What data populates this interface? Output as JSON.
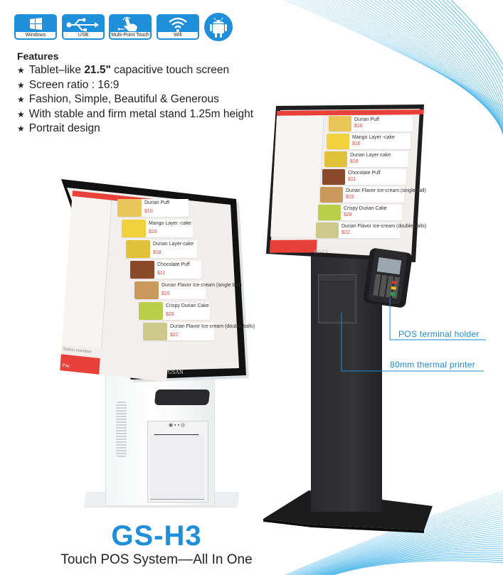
{
  "badges": [
    {
      "icon": "windows-icon",
      "label": "Windows"
    },
    {
      "icon": "usb-icon",
      "label": "USB"
    },
    {
      "icon": "multi-touch-icon",
      "label": "Multi-Point Touch"
    },
    {
      "icon": "wifi-icon",
      "label": "Wifi"
    },
    {
      "icon": "android-icon",
      "label": ""
    }
  ],
  "features": {
    "title": "Features",
    "items": [
      {
        "pre": "Tablet–like ",
        "bold": "21.5\"",
        "post": " capacitive touch screen"
      },
      {
        "pre": "Screen ratio : 16:9",
        "bold": "",
        "post": ""
      },
      {
        "pre": "Fashion, Simple, Beautiful & Generous",
        "bold": "",
        "post": ""
      },
      {
        "pre": "With stable and firm metal stand 1.25m height",
        "bold": "",
        "post": ""
      },
      {
        "pre": "Portrait design",
        "bold": "",
        "post": ""
      }
    ]
  },
  "menu": {
    "items": [
      {
        "name": "Durian Puff",
        "price": "$10",
        "color": "#e9c65a"
      },
      {
        "name": "Mango  Layer -cake",
        "price": "$16",
        "color": "#f2d23c"
      },
      {
        "name": "Durian Layer-cake",
        "price": "$18",
        "color": "#e2c13a"
      },
      {
        "name": "Chocolate Puff",
        "price": "$11",
        "color": "#8a4a2a"
      },
      {
        "name": "Durian Flavor Ice-cream  (single ball)",
        "price": "$15",
        "color": "#c99a5c"
      },
      {
        "name": "Crispy Durian Cake",
        "price": "$28",
        "color": "#b9cf4a"
      },
      {
        "name": "Durian Flavor Ice-cream  (double balls)",
        "price": "$22",
        "color": "#cdc98a"
      }
    ],
    "select_member": "Select member",
    "pay": "Pay",
    "brand": "GSAN"
  },
  "callouts": {
    "pos_holder": "POS terminal holder",
    "printer": "80mm thermal printer"
  },
  "product": {
    "model": "GS-H3",
    "tagline": "Touch POS System––All In One"
  },
  "colors": {
    "accent": "#1e8fd8",
    "app_red": "#e8413a"
  }
}
